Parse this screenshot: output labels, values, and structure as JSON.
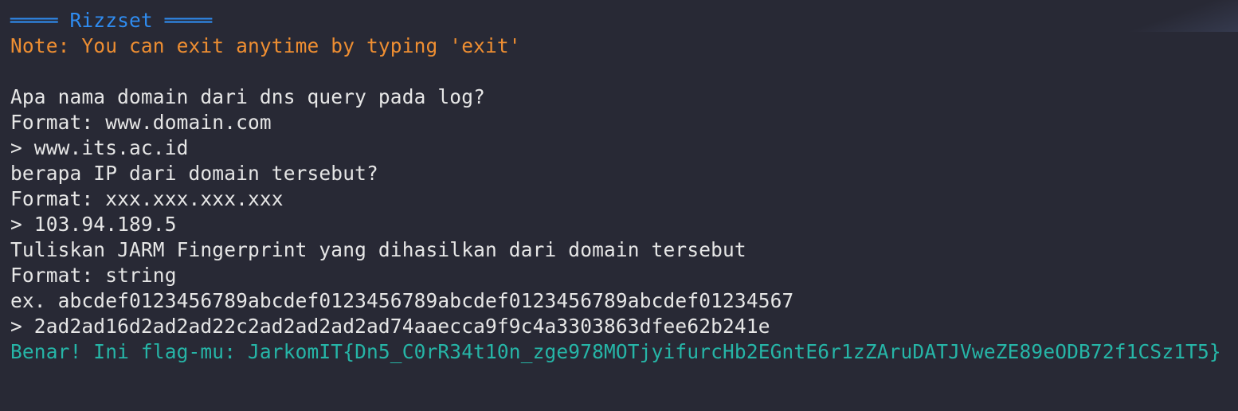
{
  "terminal": {
    "header": "════ Rizzset ════",
    "note": "Note: You can exit anytime by typing 'exit'",
    "q1": "Apa nama domain dari dns query pada log?",
    "q1_format": "Format: www.domain.com",
    "a1": "> www.its.ac.id",
    "q2": "berapa IP dari domain tersebut?",
    "q2_format": "Format: xxx.xxx.xxx.xxx",
    "a2": "> 103.94.189.5",
    "q3": "Tuliskan JARM Fingerprint yang dihasilkan dari domain tersebut",
    "q3_format": "Format: string",
    "q3_example": "ex. abcdef0123456789abcdef0123456789abcdef0123456789abcdef01234567",
    "a3": "> 2ad2ad16d2ad2ad22c2ad2ad2ad2ad74aaecca9f9c4a3303863dfee62b241e",
    "result": "Benar! Ini flag-mu: JarkomIT{Dn5_C0rR34t10n_zge978MOTjyifurcHb2EGntE6r1zZAruDATJVweZE89eODB72f1CSz1T5}"
  },
  "colors": {
    "background": "#282935",
    "header": "#2f8cf0",
    "note": "#ee8e32",
    "text": "#e6e6e6",
    "success": "#26b5a7"
  }
}
